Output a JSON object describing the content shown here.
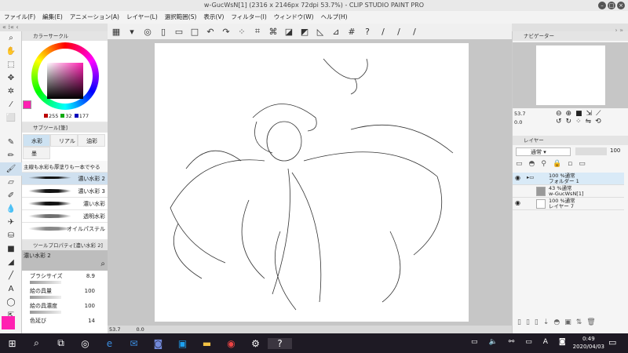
{
  "window": {
    "title": "w-GucWsN[1] (2316 x 2146px 72dpi 53.7%)  - CLIP STUDIO PAINT PRO"
  },
  "menu": [
    "ファイル(F)",
    "編集(E)",
    "アニメーション(A)",
    "レイヤー(L)",
    "選択範囲(S)",
    "表示(V)",
    "フィルター(I)",
    "ウィンドウ(W)",
    "ヘルプ(H)"
  ],
  "color_panel": {
    "tab": "カラーサークル",
    "r": "255",
    "g": "32",
    "b": "177",
    "main_color": "#ff20b1"
  },
  "subtool": {
    "tab": "サブツール[筆]",
    "categories": [
      "水彩",
      "リアル",
      "油彩",
      "墨"
    ],
    "group_title": "主線も水彩も厚塗りも一本でやる",
    "brushes": [
      "濃い水彩 2",
      "濃い水彩 3",
      "濃い水彩",
      "透明水彩",
      "オイルパステル"
    ]
  },
  "tool_property": {
    "tab": "ツールプロパティ[濃い水彩 2]",
    "brush_name": "濃い水彩 2",
    "props": [
      {
        "label": "ブラシサイズ",
        "value": "8.9"
      },
      {
        "label": "絵の具量",
        "value": "100"
      },
      {
        "label": "絵の具濃度",
        "value": "100"
      },
      {
        "label": "色延び",
        "value": "14"
      }
    ]
  },
  "status": {
    "zoom": "53.7",
    "rotation": "0.0"
  },
  "navigator": {
    "tab": "ナビゲーター",
    "zoom": "53.7",
    "rotation": "0.0"
  },
  "layers": {
    "tab": "レイヤー",
    "blend": "通常",
    "opacity": "100",
    "items": [
      {
        "line1": "100 %通常",
        "line2": "フォルダー 1",
        "folder": true
      },
      {
        "line1": "43 %通常",
        "line2": "w-GucWsN[1]"
      },
      {
        "line1": "100 %通常",
        "line2": "レイヤー 7"
      }
    ]
  },
  "clock": {
    "time": "0:49",
    "date": "2020/04/03"
  }
}
